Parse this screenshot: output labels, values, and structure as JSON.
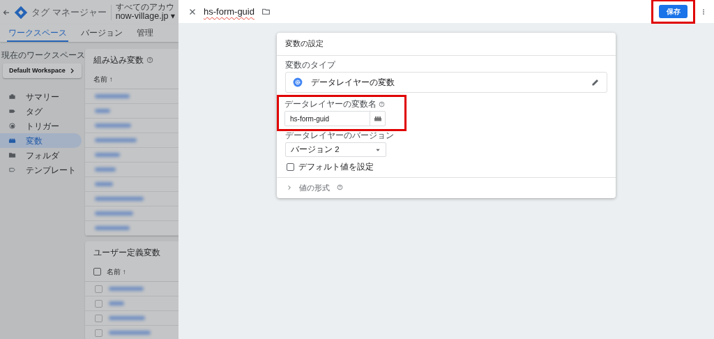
{
  "app": {
    "title": "タグ マネージャー",
    "breadcrumb": "すべてのアカウ",
    "container": "now-village.jp ▾"
  },
  "tabs": [
    {
      "label": "ワークスペース",
      "selected": true
    },
    {
      "label": "バージョン",
      "selected": false
    },
    {
      "label": "管理",
      "selected": false
    }
  ],
  "workspace": {
    "label": "現在のワークスペース",
    "name": "Default Workspace"
  },
  "sidebar": {
    "items": [
      {
        "label": "サマリー",
        "selected": false
      },
      {
        "label": "タグ",
        "selected": false
      },
      {
        "label": "トリガー",
        "selected": false
      },
      {
        "label": "変数",
        "selected": true
      },
      {
        "label": "フォルダ",
        "selected": false
      },
      {
        "label": "テンプレート",
        "selected": false
      }
    ]
  },
  "builtin_variables": {
    "title": "組み込み変数",
    "column": "名前 ↑",
    "rows": [
      {
        "kind": "blurred"
      },
      {
        "kind": "blurred"
      },
      {
        "kind": "blurred"
      },
      {
        "kind": "blurred"
      },
      {
        "kind": "blurred"
      },
      {
        "kind": "blurred"
      },
      {
        "kind": "blurred"
      },
      {
        "kind": "blurred"
      },
      {
        "kind": "blurred"
      },
      {
        "kind": "blurred"
      }
    ]
  },
  "user_variables": {
    "title": "ユーザー定義変数",
    "column": "名前 ↑",
    "header_checked": false,
    "rows": [
      {
        "kind": "blurred",
        "checked": false
      },
      {
        "kind": "blurred",
        "checked": false
      },
      {
        "kind": "blurred",
        "checked": false
      },
      {
        "kind": "blurred",
        "checked": false
      }
    ]
  },
  "panel": {
    "name": "hs-form-guid",
    "save": {
      "label": "保存",
      "highlighted": true
    },
    "card": {
      "title": "変数の設定",
      "type_label": "変数のタイプ",
      "type": "データレイヤーの変数",
      "name_field": {
        "label": "データレイヤーの変数名",
        "value": "hs-form-guid",
        "highlighted": true
      },
      "version_field": {
        "label": "データレイヤーのバージョン",
        "value": "バージョン 2"
      },
      "default_value": {
        "label": "デフォルト値を設定",
        "checked": false
      },
      "format": {
        "label": "値の形式",
        "expanded": false
      }
    }
  }
}
